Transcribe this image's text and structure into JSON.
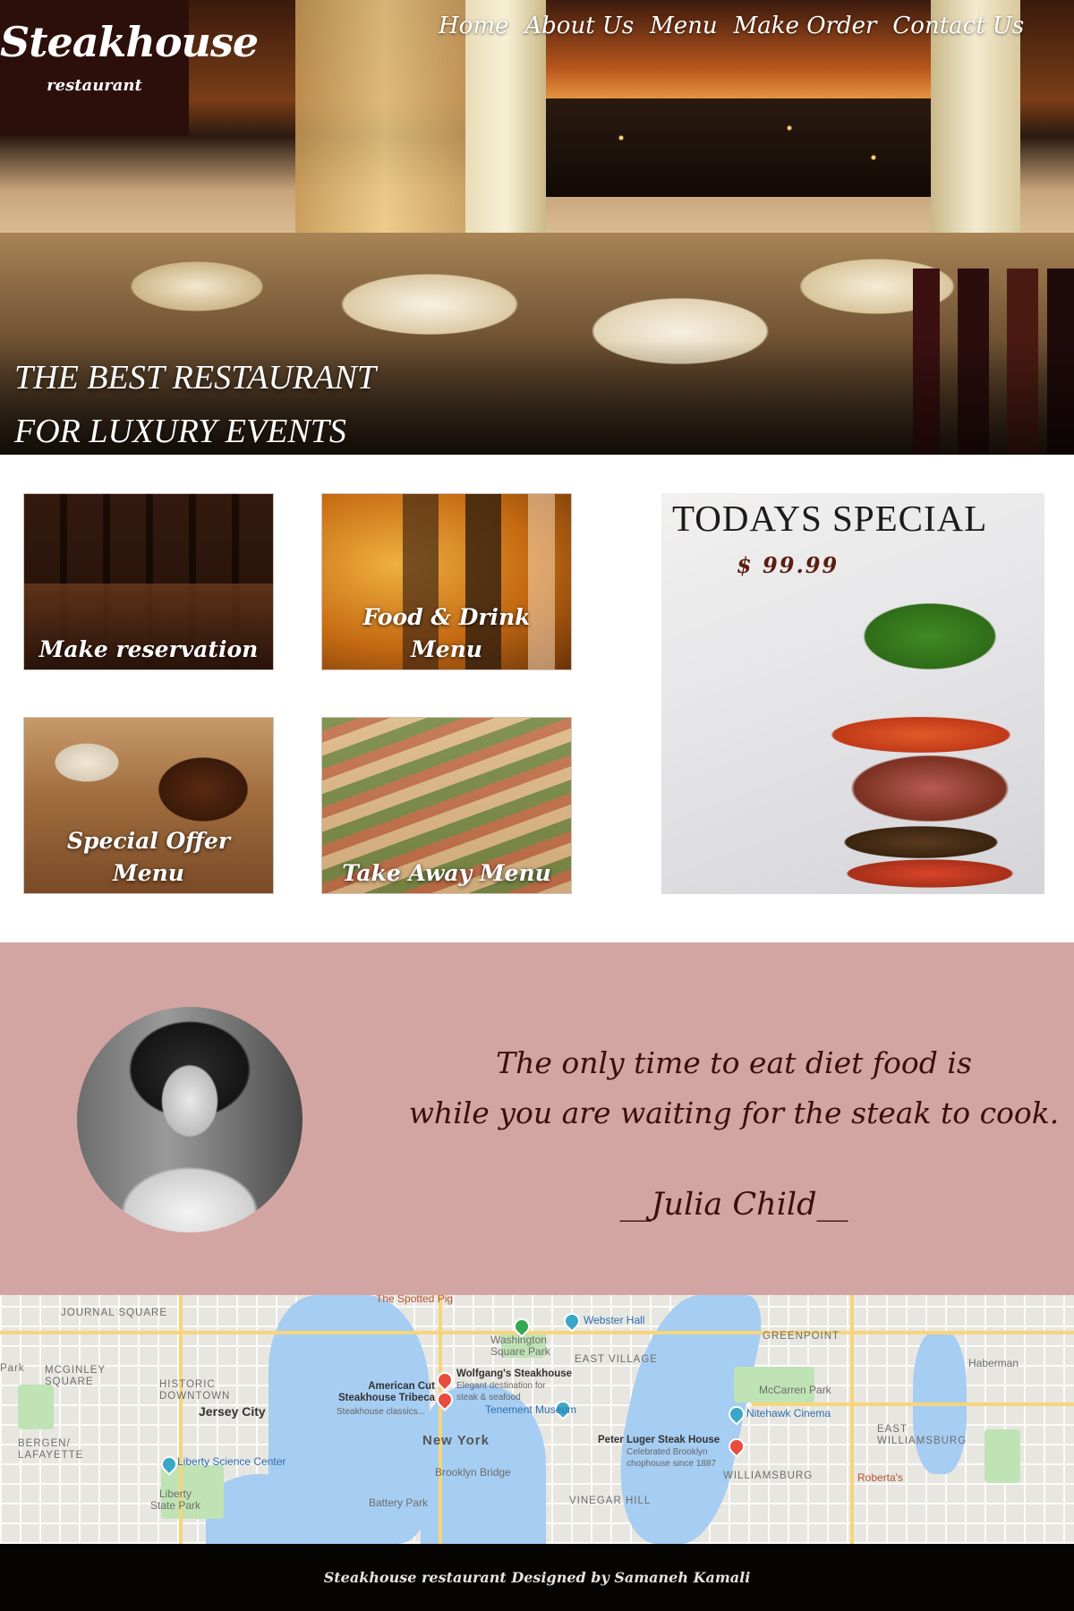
{
  "brand": {
    "name": "Steakhouse",
    "subtitle": "restaurant"
  },
  "nav": {
    "items": [
      {
        "label": "Home"
      },
      {
        "label": "About Us"
      },
      {
        "label": "Menu"
      },
      {
        "label": "Make Order"
      },
      {
        "label": "Contact Us"
      }
    ]
  },
  "hero": {
    "tagline_line1": "THE BEST RESTAURANT",
    "tagline_line2": "FOR LUXURY EVENTS"
  },
  "tiles": [
    {
      "label": "Make reservation"
    },
    {
      "label": "Food & Drink Menu"
    },
    {
      "label": "Special Offer Menu"
    },
    {
      "label": "Take Away Menu"
    }
  ],
  "special": {
    "title": "TODAYS SPECIAL",
    "price": "$ 99.99"
  },
  "quote": {
    "line1": "The only time to eat diet food is",
    "line2": "while you are waiting for the steak to cook.",
    "author": "__Julia Child__"
  },
  "map": {
    "labels": {
      "journal_square": "JOURNAL SQUARE",
      "spotted_pig": "The Spotted Pig",
      "webster_hall": "Webster Hall",
      "greenpoint": "GREENPOINT",
      "washington_square": "Washington Square Park",
      "east_village": "EAST VILLAGE",
      "mcginley_square": "MCGINLEY SQUARE",
      "historic_downtown": "HISTORIC DOWNTOWN",
      "jersey_city": "Jersey City",
      "wolfgangs": "Wolfgang's Steakhouse",
      "wolfgangs_desc": "Elegant destination for steak & seafood",
      "american_cut": "American Cut Steakhouse Tribeca",
      "american_cut_desc": "Steakhouse classics...",
      "haberman": "Haberman",
      "mccarren_park": "McCarren Park",
      "tenement_museum": "Tenement Museum",
      "nitehawk": "Nitehawk Cinema",
      "bergen_lafayette": "BERGEN/ LAFAYETTE",
      "liberty_science": "Liberty Science Center",
      "new_york": "New York",
      "peter_luger": "Peter Luger Steak House",
      "peter_luger_desc": "Celebrated Brooklyn chophouse since 1887",
      "east_williamsburg": "EAST WILLIAMSBURG",
      "williamsburg": "WILLIAMSBURG",
      "brooklyn_bridge": "Brooklyn Bridge",
      "liberty_state_park": "Liberty State Park",
      "battery_park": "Battery Park",
      "vinegar_hill": "VINEGAR HILL",
      "robertas": "Roberta's",
      "park_label": "Park"
    }
  },
  "footer": {
    "text": "Steakhouse restaurant  Designed by Samaneh Kamali"
  }
}
